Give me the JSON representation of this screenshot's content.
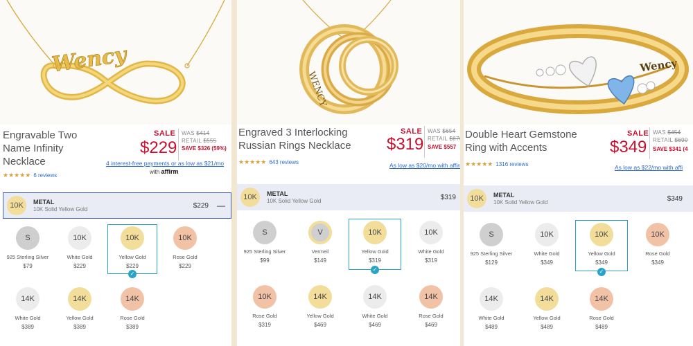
{
  "products": [
    {
      "title_lines": [
        "Engravable Two",
        "Name Infinity",
        "Necklace"
      ],
      "sale": "SALE",
      "price": "$229",
      "was_label": "WAS",
      "was": "$414",
      "retail_label": "RETAIL",
      "retail": "$555",
      "save": "SAVE $326 (59%)",
      "stars": "★★★★★",
      "reviews": "6 reviews",
      "affirm": "4 interest-free payments or as low as $21/mo",
      "affirm_with": "with",
      "affirm_brand": "affirm",
      "metal": {
        "badge": "10K",
        "title": "METAL",
        "sub": "10K Solid Yellow Gold",
        "price": "$229",
        "minus": "—"
      },
      "options": [
        {
          "code": "S",
          "name": "925 Sterling Silver",
          "price": "$79",
          "color": "silver"
        },
        {
          "code": "10K",
          "name": "White Gold",
          "price": "$229",
          "color": "white"
        },
        {
          "code": "10K",
          "name": "Yellow Gold",
          "price": "$229",
          "color": "gold"
        },
        {
          "code": "10K",
          "name": "Rose Gold",
          "price": "$229",
          "color": "rose"
        },
        {
          "code": "14K",
          "name": "White Gold",
          "price": "$389",
          "color": "white"
        },
        {
          "code": "14K",
          "name": "Yellow Gold",
          "price": "$389",
          "color": "gold"
        },
        {
          "code": "14K",
          "name": "Rose Gold",
          "price": "$389",
          "color": "rose"
        }
      ]
    },
    {
      "title_lines": [
        "Engraved 3 Interlocking",
        "Russian Rings Necklace"
      ],
      "sale": "SALE",
      "price": "$319",
      "was_label": "WAS",
      "was": "$654",
      "retail_label": "RETAIL",
      "retail": "$876",
      "save": "SAVE $557",
      "stars": "★★★★★",
      "reviews": "643 reviews",
      "affirm": "As low as $20/mo with affirm",
      "metal": {
        "badge": "10K",
        "title": "METAL",
        "sub": "10K Solid Yellow Gold",
        "price": "$319"
      },
      "options": [
        {
          "code": "S",
          "name": "925 Sterling Silver",
          "price": "$99",
          "color": "silver"
        },
        {
          "code": "V",
          "name": "Vermeil",
          "price": "$149",
          "color": "gold"
        },
        {
          "code": "10K",
          "name": "Yellow Gold",
          "price": "$319",
          "color": "gold"
        },
        {
          "code": "10K",
          "name": "White Gold",
          "price": "$319",
          "color": "white"
        },
        {
          "code": "10K",
          "name": "Rose Gold",
          "price": "$319",
          "color": "rose"
        },
        {
          "code": "14K",
          "name": "Yellow Gold",
          "price": "$469",
          "color": "gold"
        },
        {
          "code": "14K",
          "name": "White Gold",
          "price": "$469",
          "color": "white"
        },
        {
          "code": "14K",
          "name": "Rose Gold",
          "price": "$469",
          "color": "rose"
        }
      ]
    },
    {
      "title_lines": [
        "Double Heart Gemstone",
        "Ring with Accents"
      ],
      "sale": "SALE",
      "price": "$349",
      "was_label": "WAS",
      "was": "$454",
      "retail_label": "RETAIL",
      "retail": "$690",
      "save": "SAVE $341 (4",
      "stars": "★★★★★",
      "reviews": "1316 reviews",
      "affirm": "As low as $22/mo with affi",
      "metal": {
        "badge": "10K",
        "title": "METAL",
        "sub": "10K Solid Yellow Gold",
        "price": "$349"
      },
      "options": [
        {
          "code": "S",
          "name": "925 Sterling Silver",
          "price": "$129",
          "color": "silver"
        },
        {
          "code": "10K",
          "name": "White Gold",
          "price": "$349",
          "color": "white"
        },
        {
          "code": "10K",
          "name": "Yellow Gold",
          "price": "$349",
          "color": "gold"
        },
        {
          "code": "10K",
          "name": "Rose Gold",
          "price": "$349",
          "color": "rose"
        },
        {
          "code": "14K",
          "name": "White Gold",
          "price": "$489",
          "color": "white"
        },
        {
          "code": "14K",
          "name": "Yellow Gold",
          "price": "$489",
          "color": "gold"
        },
        {
          "code": "14K",
          "name": "Rose Gold",
          "price": "$489",
          "color": "rose"
        }
      ]
    }
  ],
  "engraving": {
    "p1": "Wency",
    "p2": "WENCY",
    "p3": "Wency"
  },
  "colors": {
    "sale_red": "#c8102e",
    "link_blue": "#2a6bd1",
    "select_teal": "#29a3c7",
    "gold": "#f3dd9a",
    "silver": "#cfcfcf",
    "white_gold": "#ececec",
    "rose": "#f1c2a6",
    "metal_bg": "#e9ecf5"
  }
}
